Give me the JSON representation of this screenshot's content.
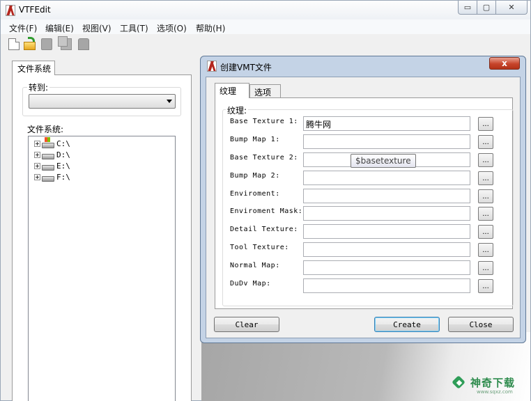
{
  "app": {
    "title": "VTFEdit",
    "caption_buttons": {
      "minimize": "▭",
      "maximize": "▢",
      "close": "✕"
    }
  },
  "menu": [
    "文件(F)",
    "编辑(E)",
    "视图(V)",
    "工具(T)",
    "选项(O)",
    "帮助(H)"
  ],
  "toolbar": [
    "new-file-icon",
    "open-folder-icon",
    "save-icon",
    "copy-icon",
    "paste-icon"
  ],
  "left_panel": {
    "tab_label": "文件系统",
    "goto_label": "转到:",
    "goto_value": "",
    "filesystem_label": "文件系统:",
    "drives": [
      "C:\\",
      "D:\\",
      "E:\\",
      "F:\\"
    ]
  },
  "dialog": {
    "title": "创建VMT文件",
    "close_symbol": "x",
    "tabs": [
      "纹理",
      "选项"
    ],
    "group_label": "纹理:",
    "fields": [
      {
        "label": "Base Texture 1:",
        "value": "腾牛网"
      },
      {
        "label": "Bump Map 1:",
        "value": ""
      },
      {
        "label": "Base Texture 2:",
        "value": ""
      },
      {
        "label": "Bump Map 2:",
        "value": ""
      },
      {
        "label": "Enviroment:",
        "value": ""
      },
      {
        "label": "Enviroment Mask:",
        "value": ""
      },
      {
        "label": "Detail Texture:",
        "value": ""
      },
      {
        "label": "Tool Texture:",
        "value": ""
      },
      {
        "label": "Normal Map:",
        "value": ""
      },
      {
        "label": "DuDv Map:",
        "value": ""
      }
    ],
    "browse_label": "...",
    "tooltip": "$basetexture",
    "buttons": {
      "clear": "Clear",
      "create": "Create",
      "close": "Close"
    }
  },
  "watermark": {
    "text": "神奇下载",
    "url": "www.sqxz.com"
  },
  "colors": {
    "dialog_frame": "#c4d3e6",
    "close_red": "#c7442a",
    "default_button": "#3c7fb1",
    "watermark_green": "#2f9d58"
  }
}
